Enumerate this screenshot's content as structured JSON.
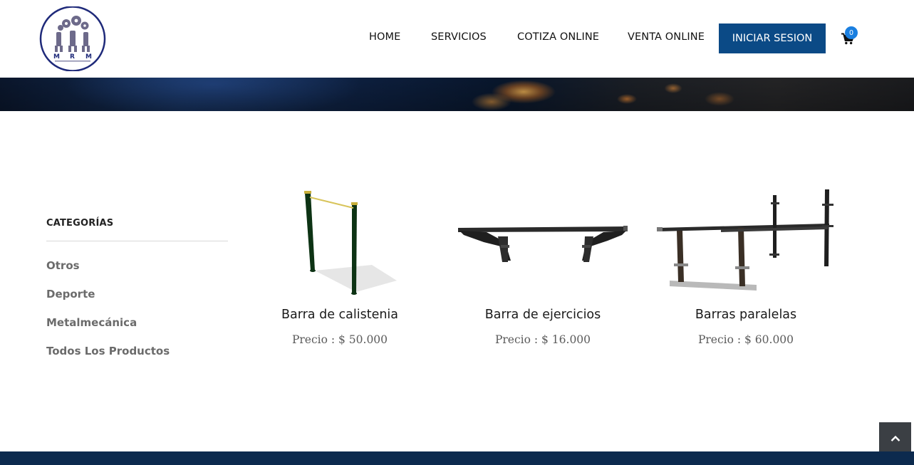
{
  "header": {
    "logo_text": "MRM",
    "nav": [
      {
        "label": "HOME"
      },
      {
        "label": "SERVICIOS"
      },
      {
        "label": "COTIZA ONLINE"
      },
      {
        "label": "VENTA ONLINE"
      }
    ],
    "login_label": "INICIAR SESION",
    "cart_count": "0",
    "cart_icon": "shopping-cart-icon"
  },
  "sidebar": {
    "title": "CATEGORÍAS",
    "items": [
      {
        "label": "Otros"
      },
      {
        "label": "Deporte"
      },
      {
        "label": "Metalmecánica"
      },
      {
        "label": "Todos Los Productos"
      }
    ]
  },
  "products": [
    {
      "name": "Barra de calistenia",
      "price": "Precio : $ 50.000"
    },
    {
      "name": "Barra de ejercicios",
      "price": "Precio : $ 16.000"
    },
    {
      "name": "Barras paralelas",
      "price": "Precio : $ 60.000"
    }
  ],
  "colors": {
    "accent": "#0b4a86",
    "badge": "#1a7fe0",
    "footer": "#0c2a4e",
    "to_top": "#3b3f44"
  },
  "icons": {
    "back_to_top": "chevron-up-icon"
  }
}
